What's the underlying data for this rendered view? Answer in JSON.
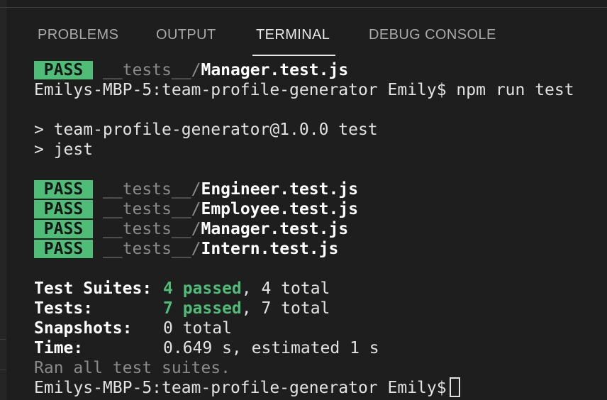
{
  "tabs": [
    {
      "label": "PROBLEMS",
      "active": false
    },
    {
      "label": "OUTPUT",
      "active": false
    },
    {
      "label": "TERMINAL",
      "active": true
    },
    {
      "label": "DEBUG CONSOLE",
      "active": false
    }
  ],
  "terminal": {
    "first_pass": {
      "badge": "PASS",
      "dir": "__tests__/",
      "file": "Manager.test.js"
    },
    "prompt_command": "Emilys-MBP-5:team-profile-generator Emily$ npm run test",
    "script_line_1": "> team-profile-generator@1.0.0 test",
    "script_line_2": "> jest",
    "results": [
      {
        "badge": "PASS",
        "dir": "__tests__/",
        "file": "Engineer.test.js"
      },
      {
        "badge": "PASS",
        "dir": "__tests__/",
        "file": "Employee.test.js"
      },
      {
        "badge": "PASS",
        "dir": "__tests__/",
        "file": "Manager.test.js"
      },
      {
        "badge": "PASS",
        "dir": "__tests__/",
        "file": "Intern.test.js"
      }
    ],
    "summary": {
      "suites_label": "Test Suites:",
      "suites_passed": "4 passed",
      "suites_total": ", 4 total",
      "tests_label": "Tests:",
      "tests_passed": "7 passed",
      "tests_total": ", 7 total",
      "snapshots_label": "Snapshots:",
      "snapshots_value": "0 total",
      "time_label": "Time:",
      "time_value": "0.649 s, estimated 1 s"
    },
    "ran_all": "Ran all test suites.",
    "final_prompt": "Emilys-MBP-5:team-profile-generator Emily$"
  },
  "colors": {
    "background": "#1e1e1e",
    "pass_badge": "#4fbd77",
    "passed_text": "#4fbd77",
    "dim_text": "#8a8a8a"
  }
}
